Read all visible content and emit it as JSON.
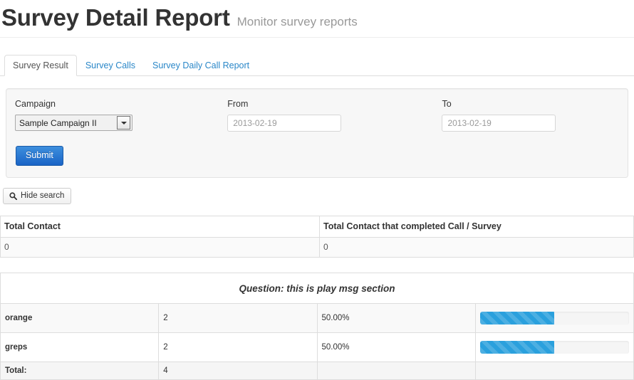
{
  "header": {
    "title": "Survey Detail Report",
    "subtitle": "Monitor survey reports"
  },
  "tabs": [
    {
      "label": "Survey Result",
      "active": true
    },
    {
      "label": "Survey Calls",
      "active": false
    },
    {
      "label": "Survey Daily Call Report",
      "active": false
    }
  ],
  "filters": {
    "campaign": {
      "label": "Campaign",
      "value": "Sample Campaign II",
      "options": [
        "Sample Campaign II"
      ]
    },
    "from": {
      "label": "From",
      "value": "",
      "placeholder": "2013-02-19"
    },
    "to": {
      "label": "To",
      "value": "",
      "placeholder": "2013-02-19"
    },
    "submit_label": "Submit"
  },
  "hide_search": {
    "label": "Hide search",
    "icon": "search-icon"
  },
  "totals_table": {
    "columns": [
      "Total Contact",
      "Total Contact that completed Call / Survey"
    ],
    "row": [
      "0",
      "0"
    ]
  },
  "question": {
    "title": "Question: this is play msg section",
    "rows": [
      {
        "label": "orange",
        "count": "2",
        "percent": "50.00%",
        "bar_pct": 50
      },
      {
        "label": "greps",
        "count": "2",
        "percent": "50.00%",
        "bar_pct": 50
      }
    ],
    "total": {
      "label": "Total:",
      "count": "4",
      "percent": ""
    }
  },
  "colors": {
    "accent": "#2a87c8",
    "bar": "#2aa0dd",
    "submit": "#1a64c6"
  }
}
